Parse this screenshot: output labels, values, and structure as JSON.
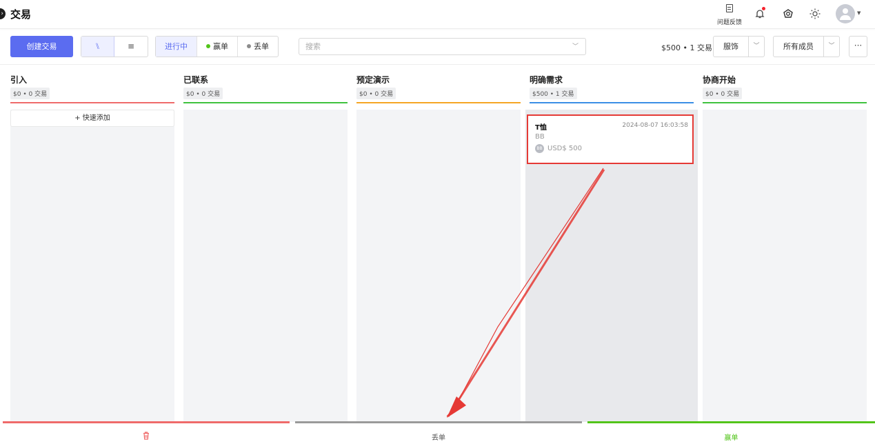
{
  "header": {
    "back_glyph": "›",
    "title": "交易",
    "feedback_label": "问题反馈",
    "icons": [
      "file-text-icon",
      "bell-icon",
      "skin-icon",
      "sun-icon",
      "avatar-icon"
    ]
  },
  "toolbar": {
    "create_label": "创建交易",
    "view_kanban_glyph": "⑊",
    "view_list_glyph": "≡",
    "status_active": "进行中",
    "status_won": "赢单",
    "status_lost": "丢单",
    "search_placeholder": "搜索",
    "summary": "$500 • 1 交易",
    "category_value": "服饰",
    "members_value": "所有成员",
    "more_glyph": "···"
  },
  "colors": {
    "primary": "#5b6cf0",
    "won_dot": "#52c41a",
    "lost_dot": "#8c8c8c",
    "card_border": "#e53935",
    "arrow": "#e53935"
  },
  "columns": [
    {
      "title": "引入",
      "stats": "$0 • 0 交易",
      "color": "#ef6a6a"
    },
    {
      "title": "已联系",
      "stats": "$0 • 0 交易",
      "color": "#3ec23e"
    },
    {
      "title": "预定演示",
      "stats": "$0 • 0 交易",
      "color": "#f5a623"
    },
    {
      "title": "明确需求",
      "stats": "$500 • 1 交易",
      "color": "#3a8ee6"
    },
    {
      "title": "协商开始",
      "stats": "$0 • 0 交易",
      "color": "#3ec23e"
    }
  ],
  "quick_add_label": "+ 快速添加",
  "deal": {
    "name": "T恤",
    "time": "2024-08-07 16:03:58",
    "org": "BB",
    "badge": "BB",
    "amount": "USD$ 500"
  },
  "drop_zones": {
    "delete_icon": "trash-icon",
    "lost_label": "丢单",
    "won_label": "赢单",
    "delete_color": "#ef6a6a",
    "lost_color": "#9a9a9a",
    "won_color": "#52c41a"
  }
}
